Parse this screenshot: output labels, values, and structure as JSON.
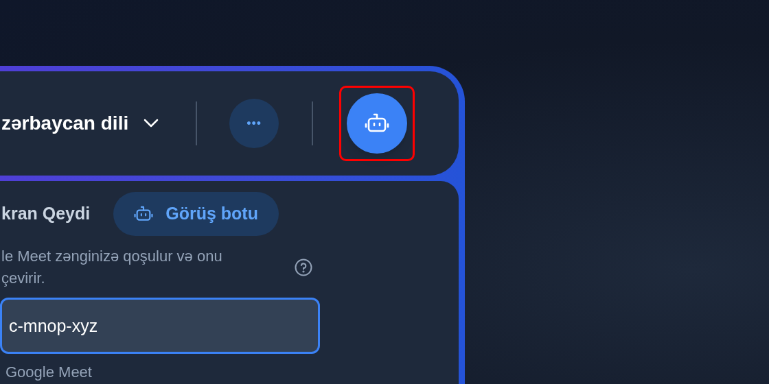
{
  "toolbar": {
    "language": "zərbaycan dili",
    "more_button": {
      "label": "•••"
    },
    "bot_button": {
      "highlighted": true
    }
  },
  "section": {
    "title": "kran Qeydi",
    "mode_pill": {
      "label": "Görüş botu",
      "selected": true
    },
    "description": [
      "le Meet zənginizə qoşulur və onu",
      "çevirir."
    ],
    "meeting_input": {
      "value": "c-mnop-xyz",
      "focused": true
    },
    "caption": "Google Meet"
  }
}
